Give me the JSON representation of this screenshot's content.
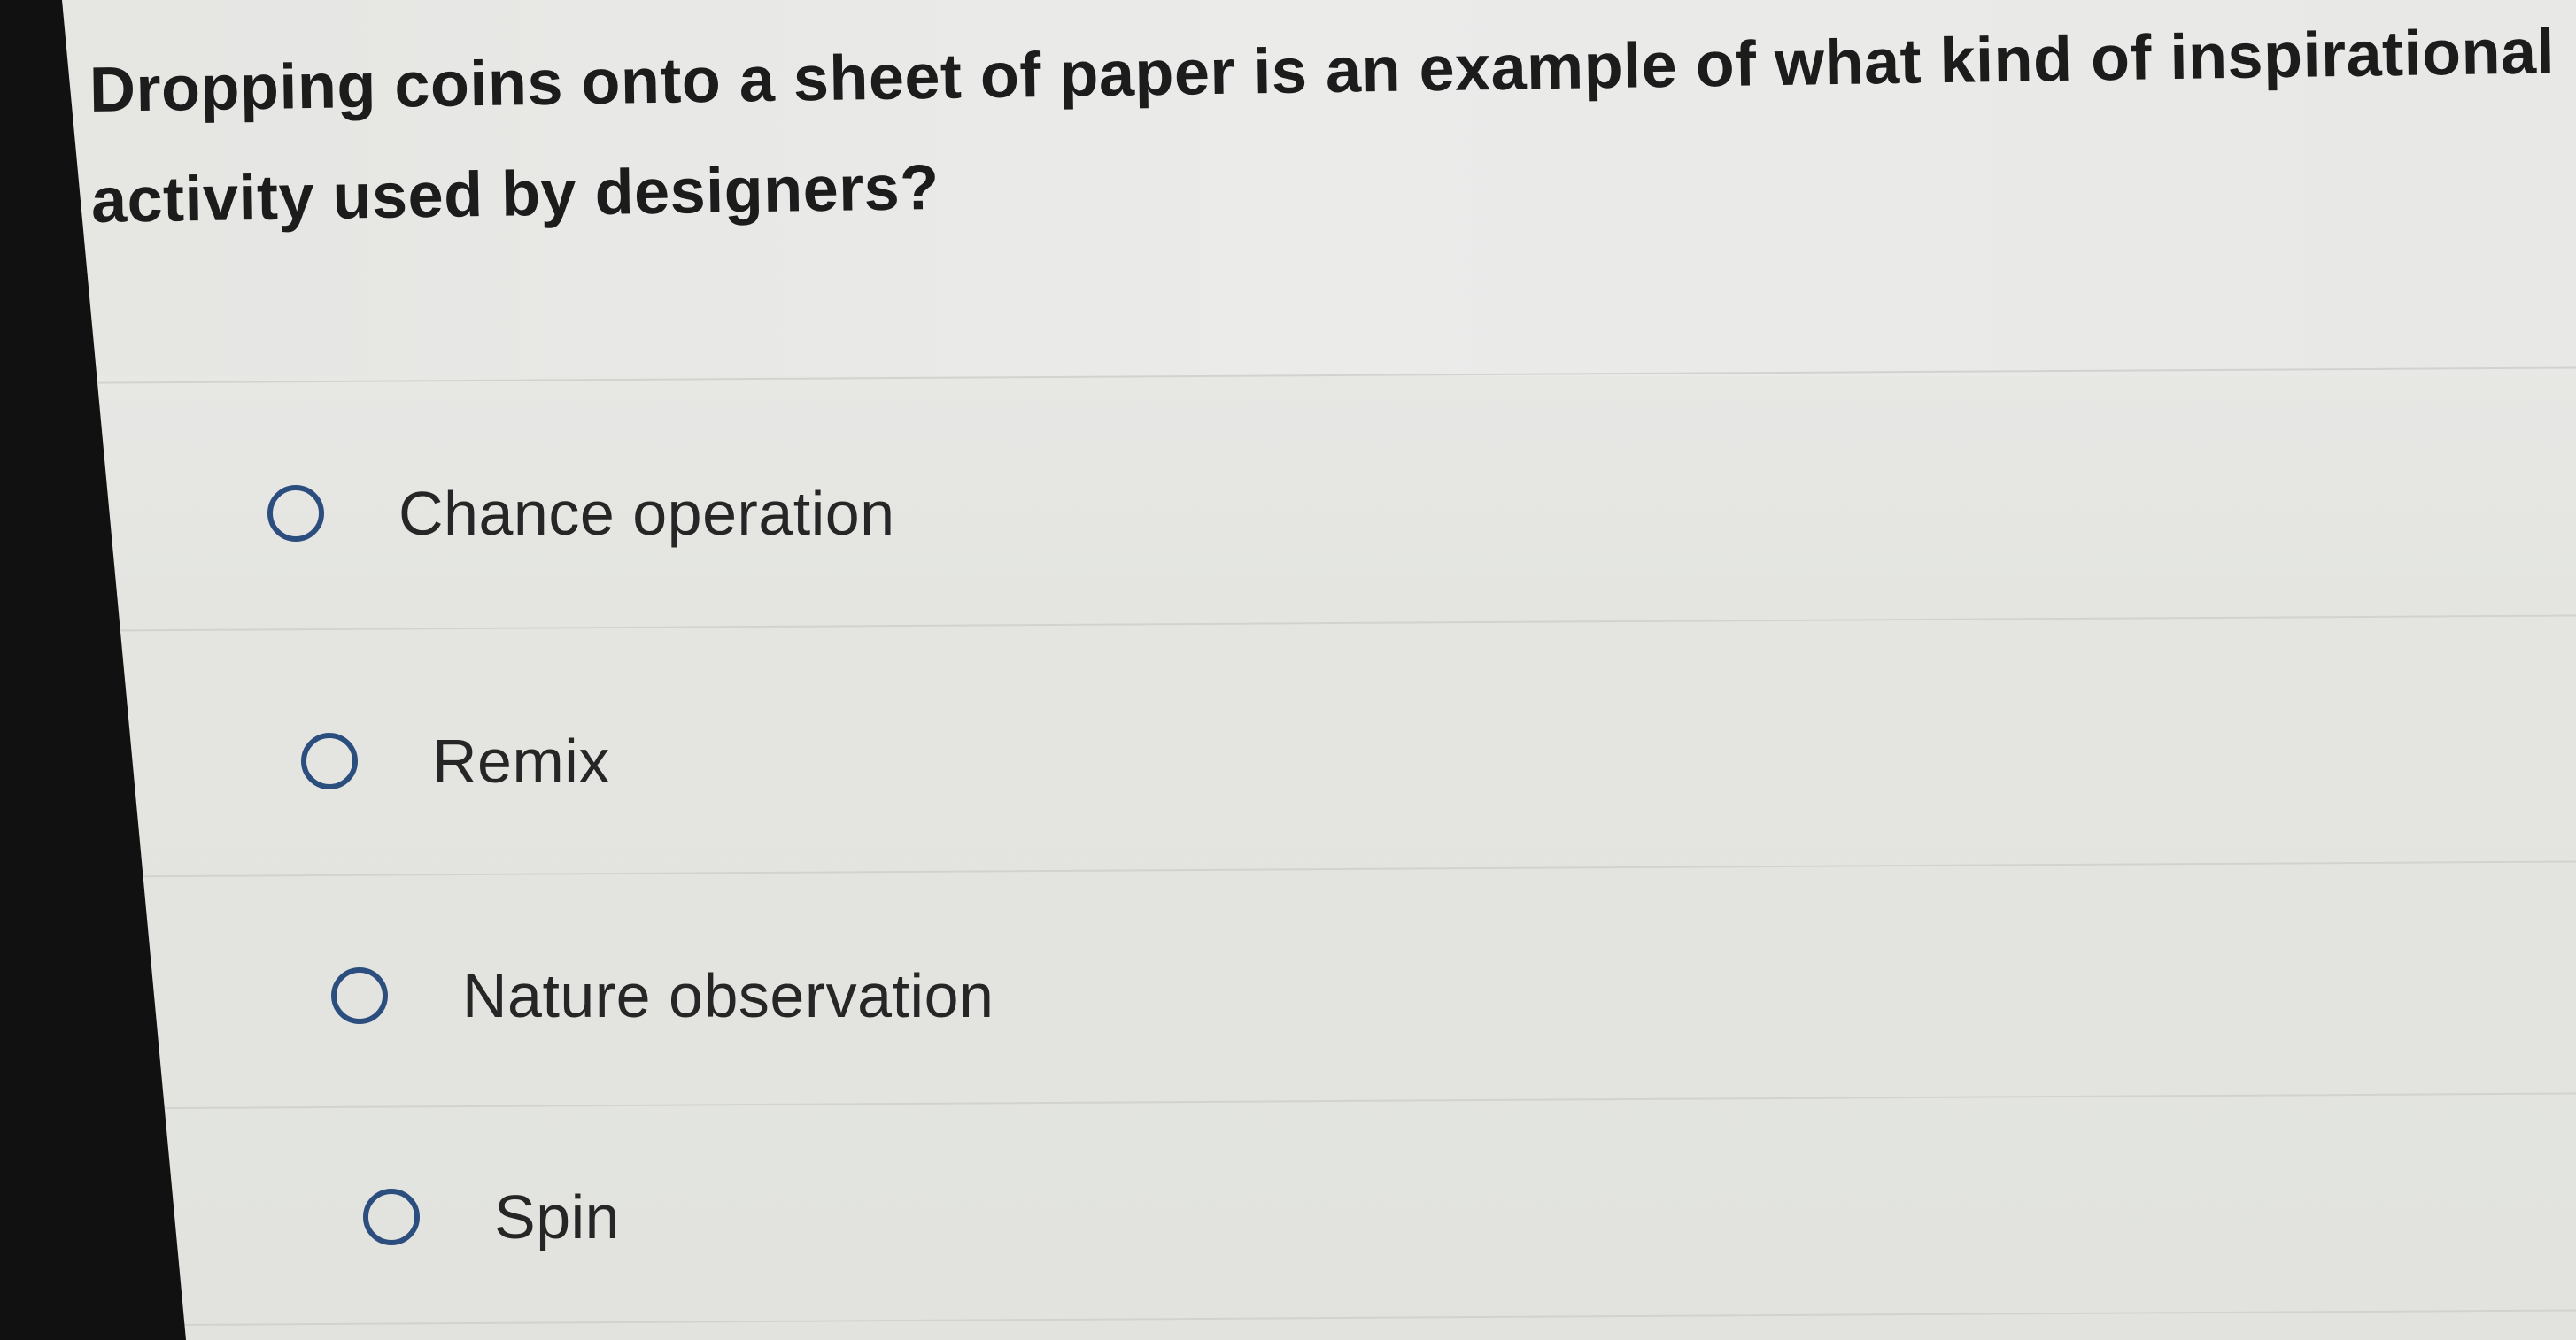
{
  "question": {
    "text": "Dropping coins onto a sheet of paper is an example of what kind of inspirational activity used by designers?"
  },
  "options": [
    {
      "label": "Chance operation",
      "selected": false
    },
    {
      "label": "Remix",
      "selected": false
    },
    {
      "label": "Nature observation",
      "selected": false
    },
    {
      "label": "Spin",
      "selected": false
    }
  ],
  "colors": {
    "radio_border": "#2c4e7e",
    "text": "#1c1c1c",
    "background": "#e6e6e1",
    "bezel": "#111111"
  }
}
